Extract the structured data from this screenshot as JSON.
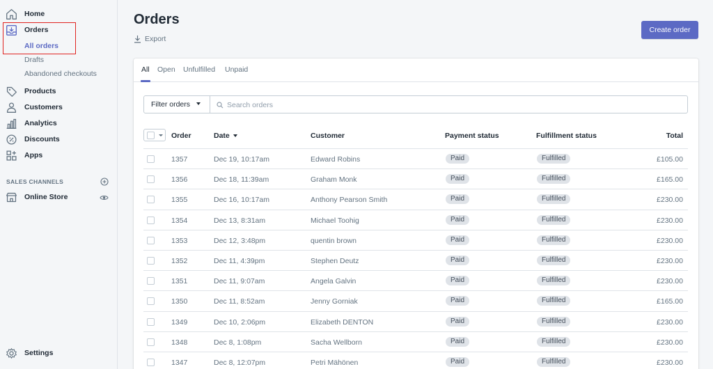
{
  "sidebar": {
    "items": [
      {
        "label": "Home",
        "icon": "home-icon"
      },
      {
        "label": "Orders",
        "icon": "orders-icon"
      },
      {
        "label": "Products",
        "icon": "tag-icon"
      },
      {
        "label": "Customers",
        "icon": "person-icon"
      },
      {
        "label": "Analytics",
        "icon": "bar-chart-icon"
      },
      {
        "label": "Discounts",
        "icon": "discount-icon"
      },
      {
        "label": "Apps",
        "icon": "apps-icon"
      }
    ],
    "order_subitems": [
      "All orders",
      "Drafts",
      "Abandoned checkouts"
    ],
    "sales_channels_title": "SALES CHANNELS",
    "online_store": "Online Store",
    "settings": "Settings"
  },
  "header": {
    "title": "Orders",
    "export_label": "Export",
    "create_order_label": "Create order"
  },
  "tabs": [
    "All",
    "Open",
    "Unfulfilled",
    "Unpaid"
  ],
  "filter": {
    "button_label": "Filter orders",
    "search_placeholder": "Search orders"
  },
  "table": {
    "columns": {
      "order": "Order",
      "date": "Date",
      "customer": "Customer",
      "payment": "Payment status",
      "fulfillment": "Fulfillment status",
      "total": "Total"
    },
    "rows": [
      {
        "order": "1357",
        "date": "Dec 19, 10:17am",
        "customer": "Edward Robins",
        "payment": "Paid",
        "fulfillment": "Fulfilled",
        "total": "£105.00"
      },
      {
        "order": "1356",
        "date": "Dec 18, 11:39am",
        "customer": "Graham Monk",
        "payment": "Paid",
        "fulfillment": "Fulfilled",
        "total": "£165.00"
      },
      {
        "order": "1355",
        "date": "Dec 16, 10:17am",
        "customer": "Anthony Pearson Smith",
        "payment": "Paid",
        "fulfillment": "Fulfilled",
        "total": "£230.00"
      },
      {
        "order": "1354",
        "date": "Dec 13, 8:31am",
        "customer": "Michael Toohig",
        "payment": "Paid",
        "fulfillment": "Fulfilled",
        "total": "£230.00"
      },
      {
        "order": "1353",
        "date": "Dec 12, 3:48pm",
        "customer": "quentin brown",
        "payment": "Paid",
        "fulfillment": "Fulfilled",
        "total": "£230.00"
      },
      {
        "order": "1352",
        "date": "Dec 11, 4:39pm",
        "customer": "Stephen Deutz",
        "payment": "Paid",
        "fulfillment": "Fulfilled",
        "total": "£230.00"
      },
      {
        "order": "1351",
        "date": "Dec 11, 9:07am",
        "customer": "Angela Galvin",
        "payment": "Paid",
        "fulfillment": "Fulfilled",
        "total": "£230.00"
      },
      {
        "order": "1350",
        "date": "Dec 11, 8:52am",
        "customer": "Jenny Gorniak",
        "payment": "Paid",
        "fulfillment": "Fulfilled",
        "total": "£165.00"
      },
      {
        "order": "1349",
        "date": "Dec 10, 2:06pm",
        "customer": "Elizabeth DENTON",
        "payment": "Paid",
        "fulfillment": "Fulfilled",
        "total": "£230.00"
      },
      {
        "order": "1348",
        "date": "Dec 8, 1:08pm",
        "customer": "Sacha Wellborn",
        "payment": "Paid",
        "fulfillment": "Fulfilled",
        "total": "£230.00"
      },
      {
        "order": "1347",
        "date": "Dec 8, 12:07pm",
        "customer": "Petri Mähönen",
        "payment": "Paid",
        "fulfillment": "Fulfilled",
        "total": "£230.00"
      }
    ]
  },
  "colors": {
    "accent": "#5c6ac4",
    "highlight": "#e0221f",
    "badge_bg": "#dfe3e8"
  }
}
